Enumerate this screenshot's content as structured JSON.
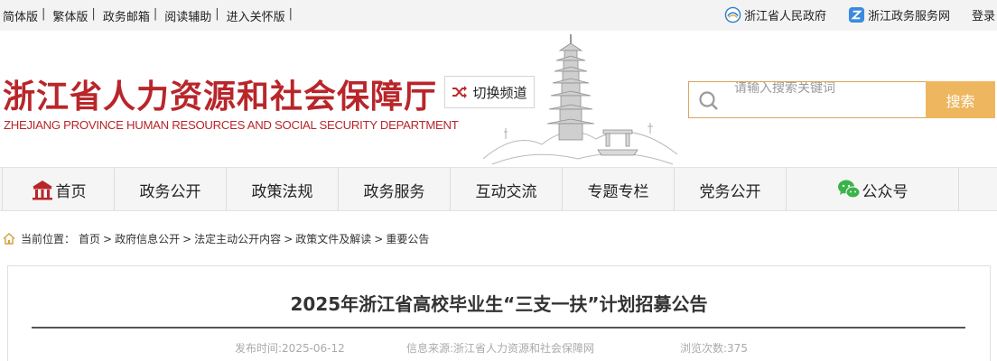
{
  "topbar": {
    "links": [
      "简体版",
      "繁体版",
      "政务邮箱",
      "阅读辅助",
      "进入关怀版"
    ],
    "separator": "|",
    "right": [
      {
        "label": "浙江省人民政府",
        "icon": "zhejiang-gov-icon"
      },
      {
        "label": "浙江政务服务网",
        "icon": "zj-service-icon"
      },
      {
        "label": "登录"
      }
    ]
  },
  "header": {
    "title_cn": "浙江省人力资源和社会保障厅",
    "title_en": "ZHEJIANG PROVINCE HUMAN RESOURCES AND SOCIAL SECURITY DEPARTMENT",
    "switch_label": "切换频道",
    "search_placeholder": "请输入搜索关键词",
    "search_button": "搜索"
  },
  "nav": {
    "items": [
      "首页",
      "政务公开",
      "政策法规",
      "政务服务",
      "互动交流",
      "专题专栏",
      "党务公开",
      "公众号"
    ]
  },
  "breadcrumb": {
    "prefix": "当前位置：",
    "items": [
      "首页",
      "政府信息公开",
      "法定主动公开内容",
      "政策文件及解读",
      "重要公告"
    ],
    "sep": ">"
  },
  "article": {
    "title": "2025年浙江省高校毕业生“三支一扶”计划招募公告",
    "publish_time": "发布时间:2025-06-12",
    "source": "信息来源:浙江省人力资源和社会保障网",
    "views": "浏览次数:375"
  },
  "colors": {
    "brand_red": "#b8262a",
    "search_orange": "#eeb65e",
    "nav_bg": "#f5f5f5",
    "topbar_bg": "#f3f3f3"
  }
}
